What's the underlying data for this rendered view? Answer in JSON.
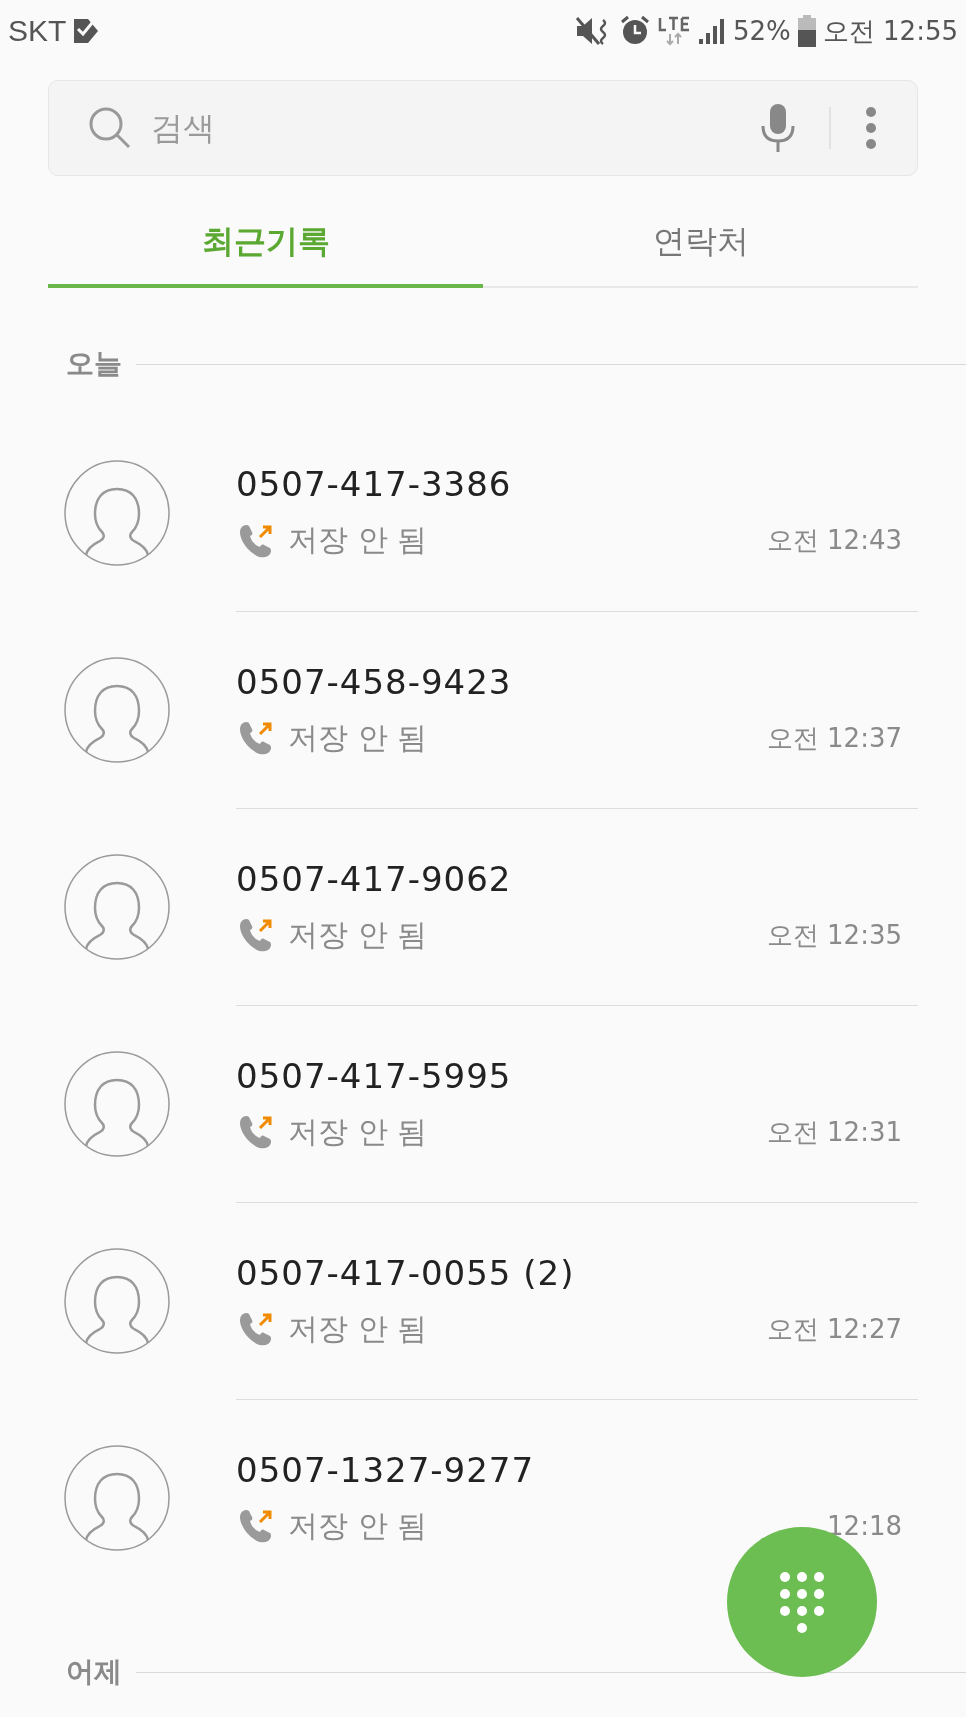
{
  "status_bar": {
    "carrier": "SKT",
    "battery_percent": "52%",
    "time": "오전 12:55"
  },
  "search": {
    "placeholder": "검색"
  },
  "tabs": [
    {
      "label": "최근기록",
      "selected": true
    },
    {
      "label": "연락처",
      "selected": false
    }
  ],
  "sections": [
    {
      "title": "오늘",
      "calls": [
        {
          "number": "0507-417-3386",
          "kind": "outgoing",
          "label": "저장 안 됨",
          "time": "오전 12:43"
        },
        {
          "number": "0507-458-9423",
          "kind": "outgoing",
          "label": "저장 안 됨",
          "time": "오전 12:37"
        },
        {
          "number": "0507-417-9062",
          "kind": "outgoing",
          "label": "저장 안 됨",
          "time": "오전 12:35"
        },
        {
          "number": "0507-417-5995",
          "kind": "outgoing",
          "label": "저장 안 됨",
          "time": "오전 12:31"
        },
        {
          "number": "0507-417-0055 (2)",
          "kind": "outgoing",
          "label": "저장 안 됨",
          "time": "오전 12:27"
        },
        {
          "number": "0507-1327-9277",
          "kind": "outgoing",
          "label": "저장 안 됨",
          "time": "12:18"
        }
      ]
    },
    {
      "title": "어제"
    }
  ]
}
